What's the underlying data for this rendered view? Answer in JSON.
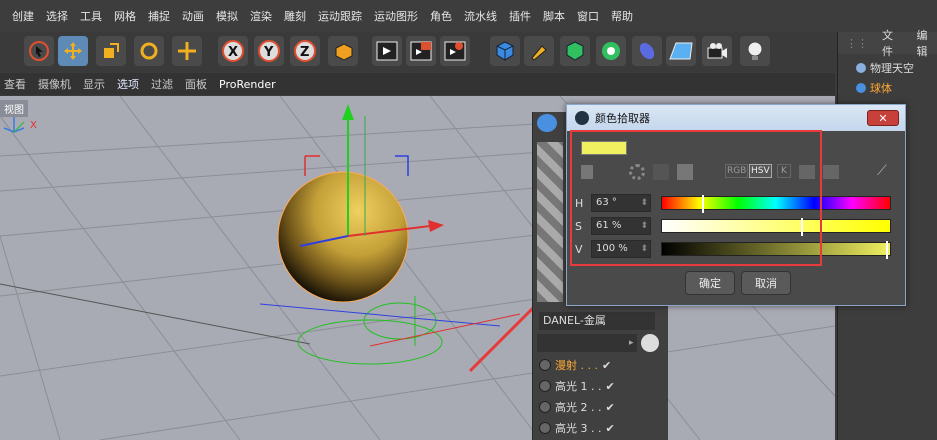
{
  "menu": [
    "创建",
    "选择",
    "工具",
    "网格",
    "捕捉",
    "动画",
    "模拟",
    "渲染",
    "雕刻",
    "运动跟踪",
    "运动图形",
    "角色",
    "流水线",
    "插件",
    "脚本",
    "窗口",
    "帮助"
  ],
  "viewbar": [
    "查看",
    "摄像机",
    "显示",
    "选项",
    "过滤",
    "面板",
    "ProRender"
  ],
  "viewport_label": "视图",
  "right_panel": {
    "menu": [
      "文件",
      "编辑"
    ],
    "items": [
      "物理天空",
      "球体"
    ]
  },
  "material": {
    "name": "DANEL-金属",
    "channels": [
      "漫射 . . .",
      "高光 1 . .",
      "高光 2 . .",
      "高光 3 . ."
    ]
  },
  "color_picker": {
    "title": "颜色拾取器",
    "mode_buttons": [
      "RGB",
      "HSV",
      "K"
    ],
    "h_label": "H",
    "h_value": "63 °",
    "s_label": "S",
    "s_value": "61 %",
    "v_label": "V",
    "v_value": "100 %",
    "h": 63,
    "s": 61,
    "v": 100,
    "ok": "确定",
    "cancel": "取消",
    "swatch": "#f0f060"
  },
  "axis_x": "X"
}
